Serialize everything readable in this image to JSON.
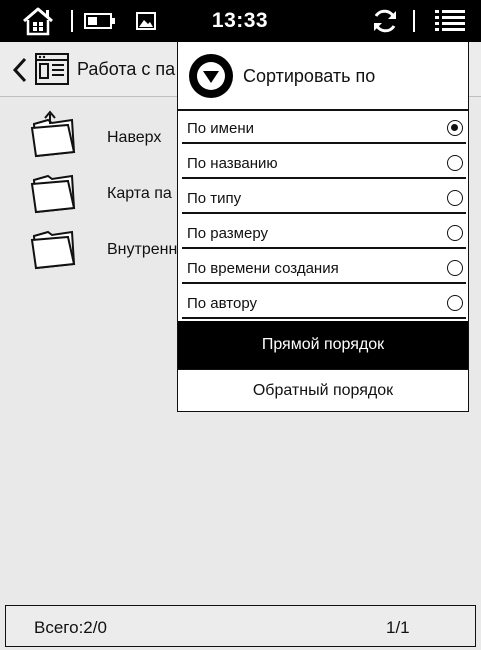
{
  "status_bar": {
    "time": "13:33",
    "icons": [
      "home-icon",
      "battery-icon",
      "gallery-icon",
      "sync-icon",
      "menu-icon"
    ]
  },
  "header": {
    "title": "Работа с па",
    "icons": [
      "back-arrow-icon",
      "file-manager-icon"
    ]
  },
  "file_list": {
    "items": [
      {
        "label": "Наверх",
        "icon": "folder-up-icon"
      },
      {
        "label": "Карта па",
        "icon": "folder-icon"
      },
      {
        "label": "Внутренн",
        "icon": "folder-icon"
      }
    ]
  },
  "sort_menu": {
    "title": "Сортировать по",
    "icon": "sort-down-circle-icon",
    "options": [
      {
        "label": "По имени",
        "selected": true
      },
      {
        "label": "По названию",
        "selected": false
      },
      {
        "label": "По типу",
        "selected": false
      },
      {
        "label": "По размеру",
        "selected": false
      },
      {
        "label": "По времени создания",
        "selected": false
      },
      {
        "label": "По автору",
        "selected": false
      }
    ],
    "direct_order_label": "Прямой порядок",
    "reverse_order_label": "Обратный порядок",
    "active_order": "direct"
  },
  "footer": {
    "total": "Всего:2/0",
    "pages": "1/1"
  }
}
